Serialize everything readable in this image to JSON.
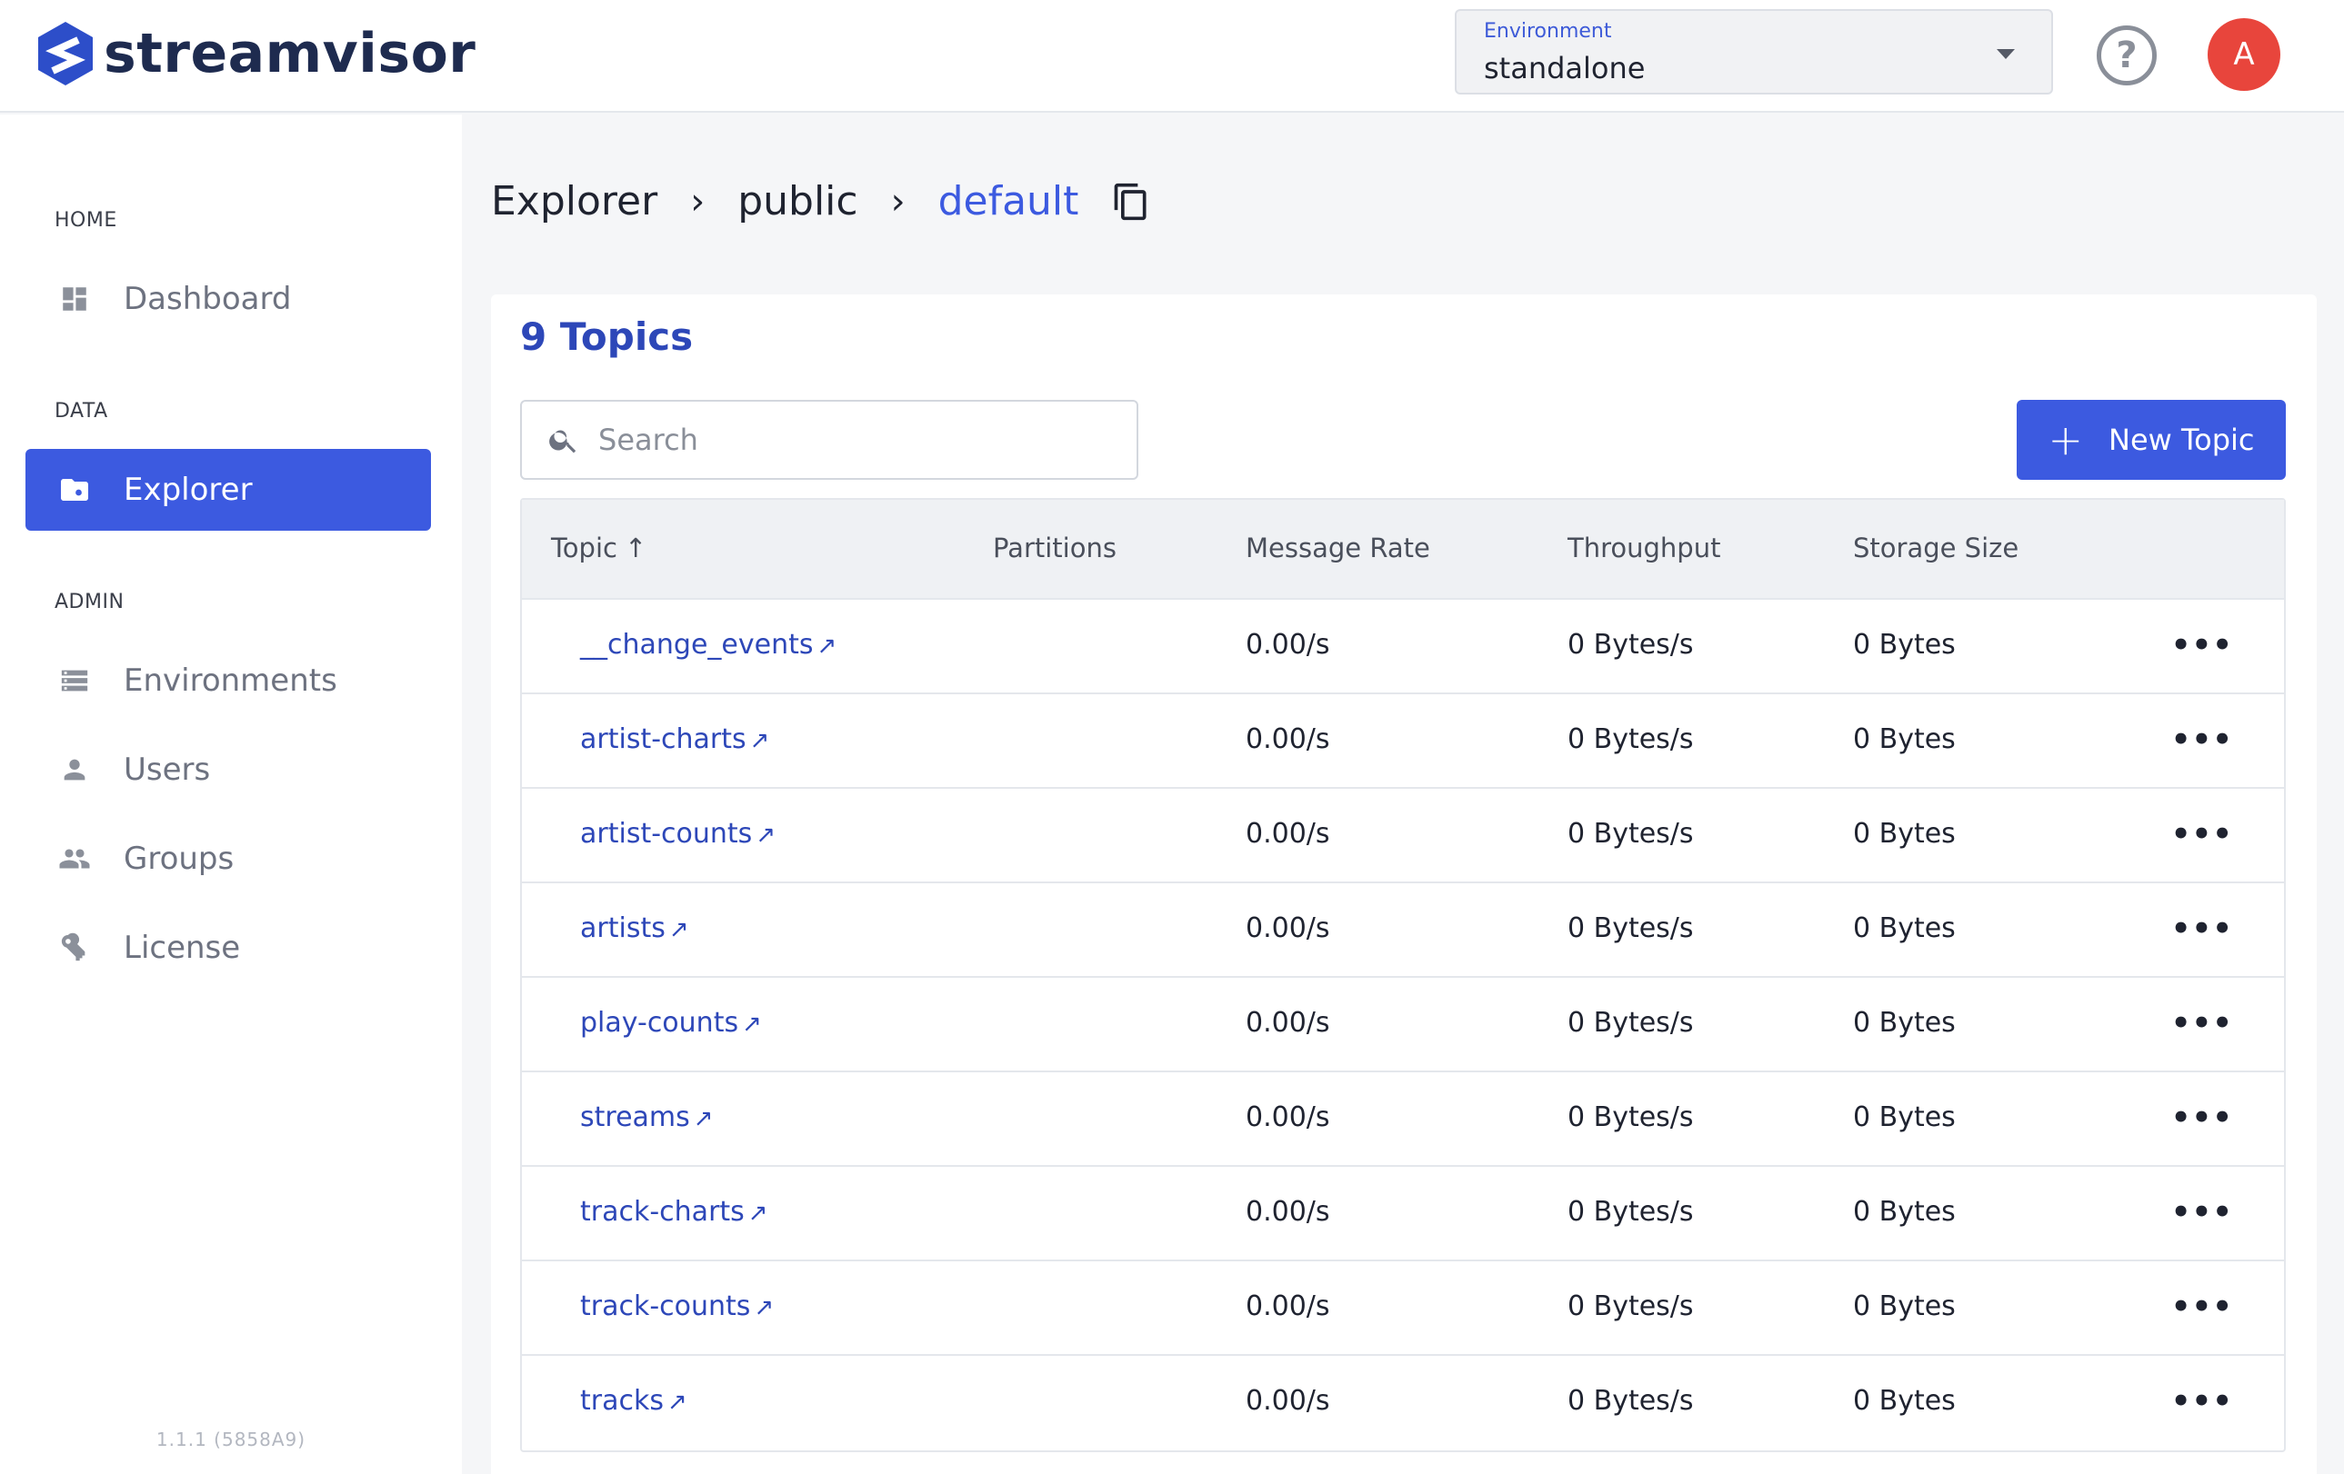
{
  "header": {
    "brand": "streamvisor",
    "environment_label": "Environment",
    "environment_value": "standalone",
    "help_glyph": "?",
    "avatar_initial": "A"
  },
  "sidebar": {
    "sections": [
      {
        "title": "HOME",
        "items": [
          {
            "label": "Dashboard",
            "icon": "dashboard-icon"
          }
        ]
      },
      {
        "title": "DATA",
        "items": [
          {
            "label": "Explorer",
            "icon": "folder-search-icon",
            "active": true
          }
        ]
      },
      {
        "title": "ADMIN",
        "items": [
          {
            "label": "Environments",
            "icon": "storage-icon"
          },
          {
            "label": "Users",
            "icon": "person-icon"
          },
          {
            "label": "Groups",
            "icon": "people-icon"
          },
          {
            "label": "License",
            "icon": "key-icon"
          }
        ]
      }
    ],
    "version": "1.1.1 (5858A9)"
  },
  "breadcrumb": [
    "Explorer",
    "public",
    "default"
  ],
  "main": {
    "title": "9 Topics",
    "search_placeholder": "Search",
    "new_button_label": "New Topic",
    "columns": [
      "Topic",
      "Partitions",
      "Message Rate",
      "Throughput",
      "Storage Size"
    ],
    "rows": [
      {
        "topic": "__change_events",
        "partitions": "",
        "rate": "0.00/s",
        "throughput": "0 Bytes/s",
        "storage": "0 Bytes"
      },
      {
        "topic": "artist-charts",
        "partitions": "",
        "rate": "0.00/s",
        "throughput": "0 Bytes/s",
        "storage": "0 Bytes"
      },
      {
        "topic": "artist-counts",
        "partitions": "",
        "rate": "0.00/s",
        "throughput": "0 Bytes/s",
        "storage": "0 Bytes"
      },
      {
        "topic": "artists",
        "partitions": "",
        "rate": "0.00/s",
        "throughput": "0 Bytes/s",
        "storage": "0 Bytes"
      },
      {
        "topic": "play-counts",
        "partitions": "",
        "rate": "0.00/s",
        "throughput": "0 Bytes/s",
        "storage": "0 Bytes"
      },
      {
        "topic": "streams",
        "partitions": "",
        "rate": "0.00/s",
        "throughput": "0 Bytes/s",
        "storage": "0 Bytes"
      },
      {
        "topic": "track-charts",
        "partitions": "",
        "rate": "0.00/s",
        "throughput": "0 Bytes/s",
        "storage": "0 Bytes"
      },
      {
        "topic": "track-counts",
        "partitions": "",
        "rate": "0.00/s",
        "throughput": "0 Bytes/s",
        "storage": "0 Bytes"
      },
      {
        "topic": "tracks",
        "partitions": "",
        "rate": "0.00/s",
        "throughput": "0 Bytes/s",
        "storage": "0 Bytes"
      }
    ]
  },
  "colors": {
    "accent": "#3c5ae0",
    "brand_text": "#1e2b4f",
    "avatar": "#e8453c"
  }
}
